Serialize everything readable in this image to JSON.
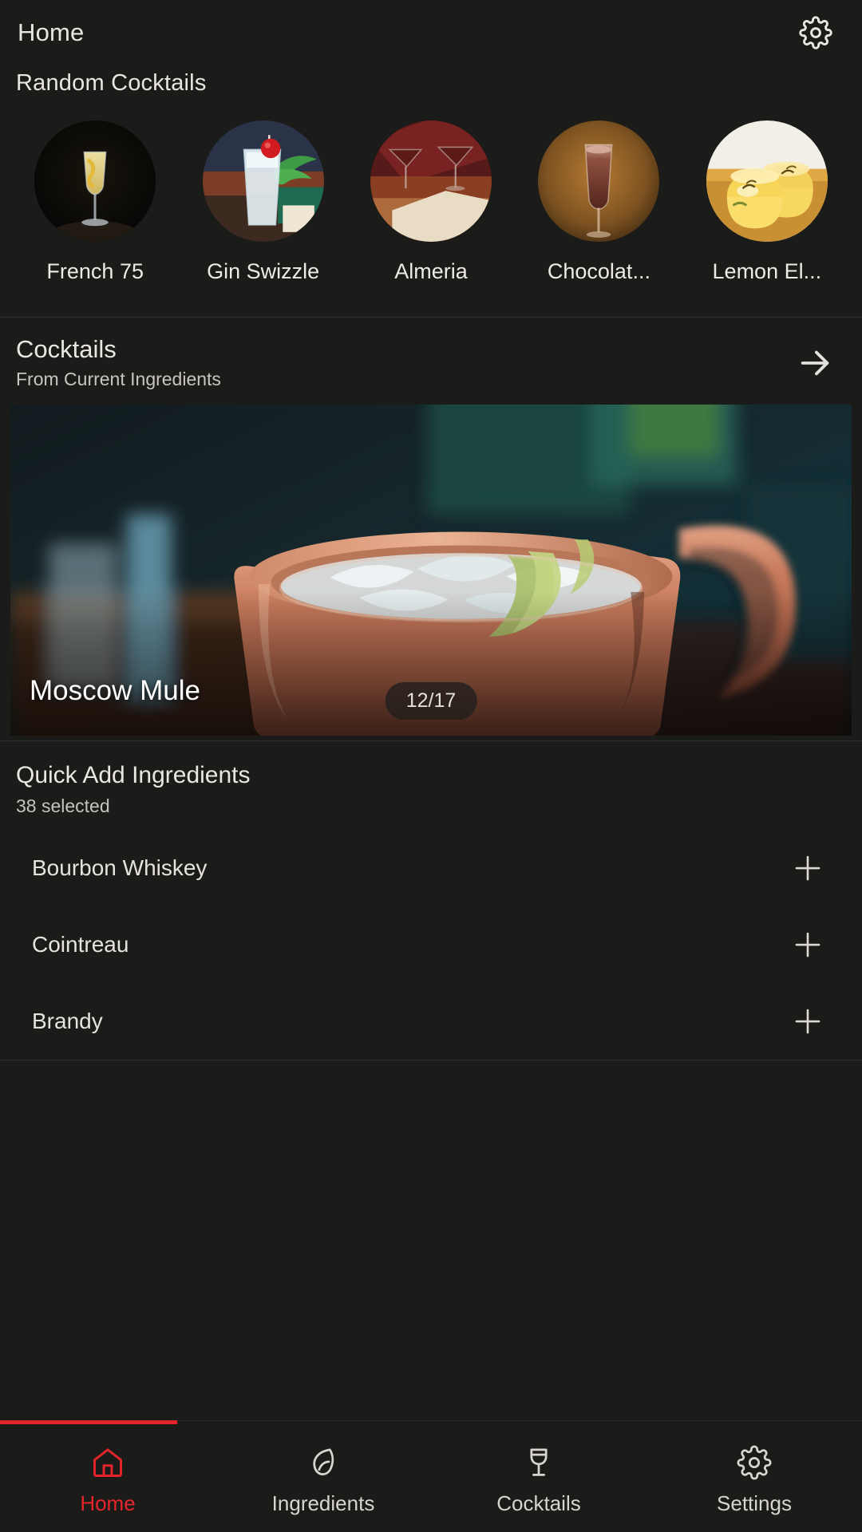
{
  "appbar": {
    "title": "Home",
    "settings_icon": "gear-icon"
  },
  "random_section": {
    "heading": "Random Cocktails",
    "items": [
      {
        "label": "French 75"
      },
      {
        "label": "Gin Swizzle"
      },
      {
        "label": "Almeria"
      },
      {
        "label": "Chocolat..."
      },
      {
        "label": "Lemon El..."
      }
    ]
  },
  "cocktails_section": {
    "title": "Cocktails",
    "subtitle": "From Current Ingredients",
    "forward_icon": "arrow-right-icon",
    "hero": {
      "name": "Moscow Mule",
      "counter": "12/17"
    }
  },
  "quick_add": {
    "title": "Quick Add Ingredients",
    "subtitle": "38 selected",
    "add_icon": "plus-icon",
    "items": [
      {
        "name": "Bourbon Whiskey"
      },
      {
        "name": "Cointreau"
      },
      {
        "name": "Brandy"
      }
    ]
  },
  "bottom_nav": {
    "active_color": "#e5252b",
    "items": [
      {
        "label": "Home",
        "icon": "home-icon"
      },
      {
        "label": "Ingredients",
        "icon": "leaf-icon"
      },
      {
        "label": "Cocktails",
        "icon": "cocktail-glass-icon"
      },
      {
        "label": "Settings",
        "icon": "gear-icon"
      }
    ]
  }
}
